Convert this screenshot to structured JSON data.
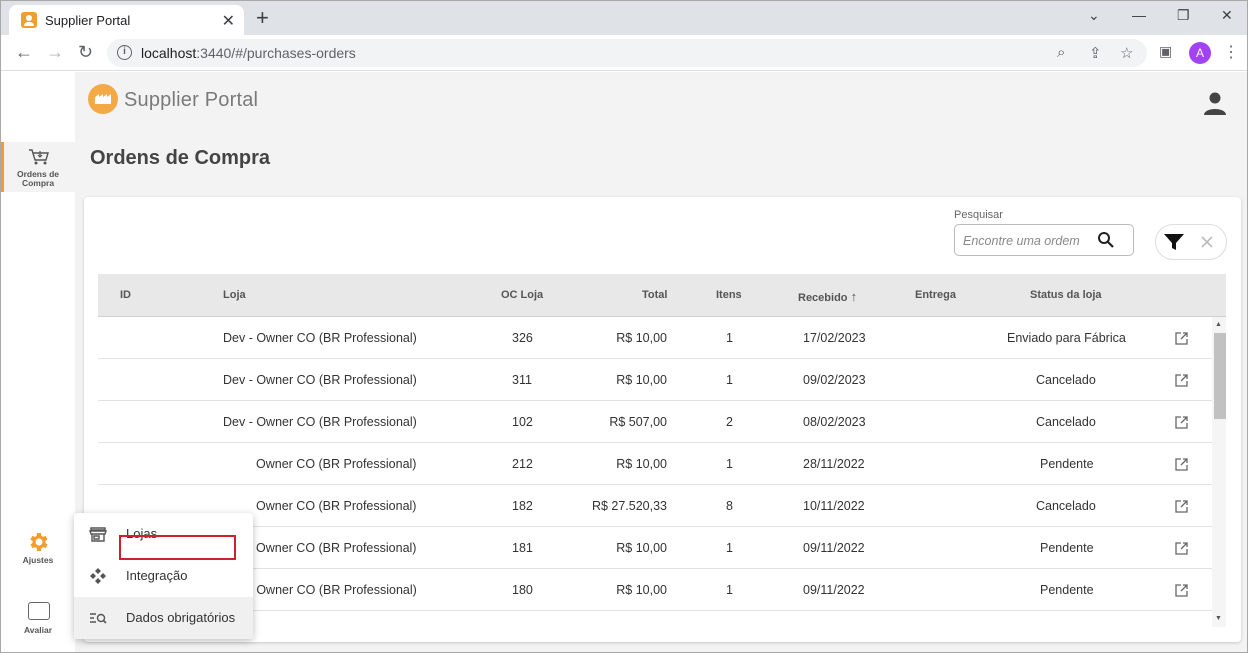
{
  "browser": {
    "tab_title": "Supplier Portal",
    "new_tab_symbol": "+",
    "url_host": "localhost",
    "url_rest": ":3440/#/purchases-orders",
    "profile_initial": "A"
  },
  "app": {
    "brand": "Supplier Portal",
    "page_title": "Ordens de Compra",
    "nav": {
      "orders_label_line1": "Ordens de",
      "orders_label_line2": "Compra",
      "settings_label": "Ajustes",
      "feedback_label": "Avaliar"
    },
    "search": {
      "label": "Pesquisar",
      "placeholder": "Encontre uma ordem"
    },
    "table": {
      "headers": {
        "id": "ID",
        "loja": "Loja",
        "oc_loja": "OC Loja",
        "total": "Total",
        "itens": "Itens",
        "recebido": "Recebido",
        "entrega": "Entrega",
        "status": "Status da loja"
      },
      "sort_indicator": "↑",
      "rows": [
        {
          "id": "",
          "loja": "Dev - Owner CO (BR Professional)",
          "oc_loja": "326",
          "total": "R$ 10,00",
          "itens": "1",
          "recebido": "17/02/2023",
          "entrega": "",
          "status": "Enviado para Fábrica"
        },
        {
          "id": "",
          "loja": "Dev - Owner CO (BR Professional)",
          "oc_loja": "311",
          "total": "R$ 10,00",
          "itens": "1",
          "recebido": "09/02/2023",
          "entrega": "",
          "status": "Cancelado"
        },
        {
          "id": "",
          "loja": "Dev - Owner CO (BR Professional)",
          "oc_loja": "102",
          "total": "R$ 507,00",
          "itens": "2",
          "recebido": "08/02/2023",
          "entrega": "",
          "status": "Cancelado"
        },
        {
          "id": "",
          "loja": "Owner CO (BR Professional)",
          "oc_loja": "212",
          "total": "R$ 10,00",
          "itens": "1",
          "recebido": "28/11/2022",
          "entrega": "",
          "status": "Pendente"
        },
        {
          "id": "",
          "loja": "Owner CO (BR Professional)",
          "oc_loja": "182",
          "total": "R$ 27.520,33",
          "itens": "8",
          "recebido": "10/11/2022",
          "entrega": "",
          "status": "Cancelado"
        },
        {
          "id": "",
          "loja": "Owner CO (BR Professional)",
          "oc_loja": "181",
          "total": "R$ 10,00",
          "itens": "1",
          "recebido": "09/11/2022",
          "entrega": "",
          "status": "Pendente"
        },
        {
          "id": "",
          "loja": "Dev - Owner CO (BR Professional)",
          "oc_loja": "180",
          "total": "R$ 10,00",
          "itens": "1",
          "recebido": "09/11/2022",
          "entrega": "",
          "status": "Pendente"
        }
      ]
    },
    "settings_menu": {
      "items": [
        {
          "label": "Lojas",
          "icon": "store-icon"
        },
        {
          "label": "Integração",
          "icon": "integration-icon"
        },
        {
          "label": "Dados obrigatórios",
          "icon": "required-data-icon"
        }
      ]
    },
    "colors": {
      "accent": "#f39c2f",
      "highlight_border": "#d0202c",
      "profile": "#a142f4"
    }
  }
}
